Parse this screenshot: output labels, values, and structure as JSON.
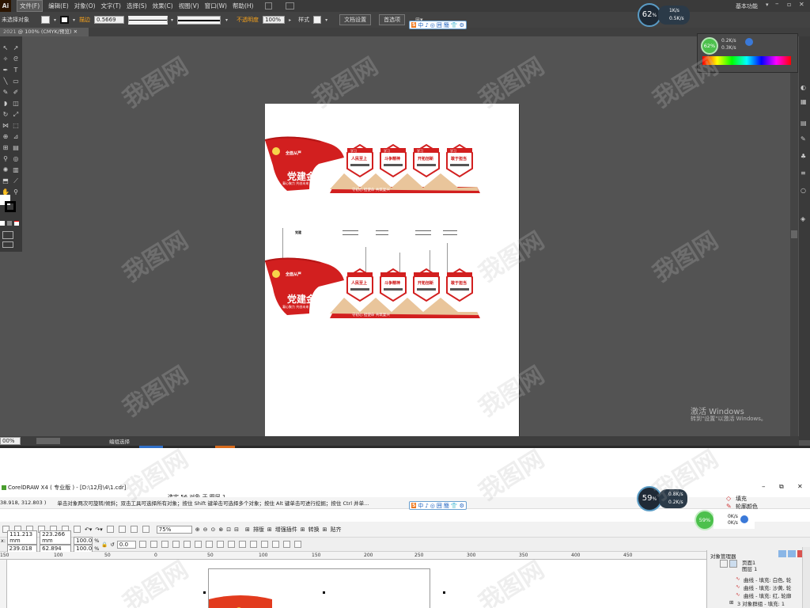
{
  "ai": {
    "logo": "Ai",
    "menu": [
      "文件(F)",
      "编辑(E)",
      "对象(O)",
      "文字(T)",
      "选择(S)",
      "效果(C)",
      "视图(V)",
      "窗口(W)",
      "帮助(H)"
    ],
    "workspace": "基本功能",
    "control": {
      "no_selection": "未选择对象",
      "stroke_label": "描边",
      "stroke_value": "0.5669",
      "uniform": "等比",
      "basic": "基本",
      "opacity_label": "不透明度",
      "opacity_value": "100%",
      "style_label": "样式",
      "doc_setup": "文档设置",
      "preferences": "首选项"
    },
    "doc_tab": "@ 100% (CMYK/预览)",
    "doc_tab_prefix": "2021",
    "status_zoom": "00%",
    "status_text": "编组选择",
    "rpanel": {
      "speed_percent": "62%",
      "up": "0.2K/s",
      "down": "0.3K/s"
    },
    "top_gauge": {
      "percent": "62",
      "unit": "%",
      "up": "1K/s",
      "down": "0.5K/s"
    },
    "activate": {
      "line1": "激活 Windows",
      "line2": "转到\"设置\"以激活 Windows。"
    }
  },
  "ime": {
    "items": [
      "中",
      "♪",
      "◎",
      "囲",
      "簡",
      "👕",
      "⚙"
    ]
  },
  "artwork": {
    "hex_titles": [
      "人民至上",
      "斗争精神",
      "开拓创新",
      "敢于担当"
    ],
    "banner": "全面从严",
    "brand_main": "党建金句",
    "slogan": "凝心聚力  共创未来",
    "bottom_bar": "守初心  担使命  共筑复兴",
    "label_small": "党建",
    "hex_badge": "学习"
  },
  "cd": {
    "title": "CorelDRAW X4 ( 专业版 ) - [D:\\12月\\4\\1.cdr]",
    "selection_info": "选定 56 对象 于 图层 1",
    "coords": "38.918, 312.803 )",
    "hint": "单击对象两次可旋转/倾斜；双击工具可选择所有对象；按住 Shift 键单击可选择多个对象；按住 Alt 键单击可进行挖掘；按住 Ctrl 并单...",
    "zoom": "75%",
    "tools": [
      "排版",
      "增强插件",
      "转换",
      "贴齐"
    ],
    "x": "111.213 mm",
    "y": "239.018 mm",
    "w": "223.266 mm",
    "h": "62.894 mm",
    "sx": "100.0",
    "sy": "100.0",
    "pct": "%",
    "rot": "0.0",
    "gauge": {
      "percent": "59",
      "unit": "%",
      "up": "0.8K/s",
      "down": "0.2K/s"
    },
    "gauge2": {
      "percent": "59%",
      "up": "0K/s",
      "down": "0K/s"
    },
    "ruler_marks": [
      "150",
      "100",
      "50",
      "0",
      "50",
      "100",
      "150",
      "200",
      "250",
      "300",
      "350",
      "400",
      "450"
    ],
    "docker": {
      "title": "对象管理器",
      "fill": "填充",
      "outline": "轮廓颜色",
      "page": "页面1",
      "layer": "图层 1",
      "items": [
        "曲线 - 填充: 白色, 轮",
        "曲线 - 填充: 沙黄, 轮",
        "曲线 - 填充: 红, 轮廓",
        "3 对象群组 - 填充: 1"
      ]
    }
  },
  "watermark": "我图网"
}
